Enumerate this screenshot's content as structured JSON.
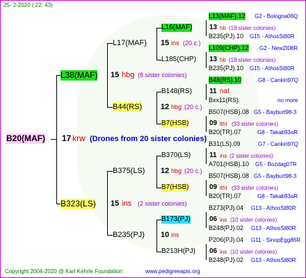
{
  "date": "25-  2-2020 (  22:  43)",
  "footer": {
    "copyright": "Copyright 2004-2020 @ Karl Kehrle Foundation",
    "site": "www.pedigreeapis.org"
  },
  "root": {
    "name": "B20(MAF)",
    "num": "17",
    "code": "krw",
    "drones": "Drones from 20 sister colonies"
  },
  "gen1": [
    {
      "name": "L38(MAF)",
      "num": "15",
      "code": "hbg",
      "note": "(8 sister colonies)"
    },
    {
      "name": "B323(LS)",
      "num": "15",
      "code": "ins",
      "note": "(2 sister colonies)"
    }
  ],
  "gen2": [
    {
      "name": "L17(MAF)",
      "num": "15",
      "code": "ins",
      "note": "(20 c.)"
    },
    {
      "name": "B44(RS)",
      "num": "12",
      "code": "hbg",
      "note": "(20 c.)"
    },
    {
      "name": "B375(LS)",
      "num": "12",
      "code": "hbg",
      "note": "(20 c.)"
    },
    {
      "name": "B235(PJ)",
      "num": "10",
      "code": "ins",
      "note": ""
    }
  ],
  "gen3": [
    {
      "name": "L16(MAF)",
      "num": "13",
      "code": "hb",
      "note": "(18 sister colonies)"
    },
    {
      "name": "L185(CHP)",
      "num": "13",
      "code": "hb",
      "note": "(18 sister colonies)"
    },
    {
      "name": "B148(RS)",
      "num": "11",
      "code": "nat",
      "note": ""
    },
    {
      "name": "B7(HSB)",
      "num": "09",
      "code": "lthl",
      "note": "(33 sister colonies)"
    },
    {
      "name": "B370(LS)",
      "num": "11",
      "code": "ins",
      "note": "(2 sister colonies)"
    },
    {
      "name": "B7(HSB)",
      "num": "09",
      "code": "lthl",
      "note": "(33 sister colonies)"
    },
    {
      "name": "B173(PJ)",
      "num": "06",
      "code": "ins",
      "note": "(10 sister colonies)"
    },
    {
      "name": "B213H(PJ)",
      "num": "06",
      "code": "ins",
      "note": "(10 sister colonies)"
    }
  ],
  "gen4": [
    {
      "left": "L13(MAF).12",
      "right": "G2 - Bologna06Q"
    },
    {
      "left": "B235(PJ).10",
      "right": "G15 - AthosSt80R"
    },
    {
      "left": "L109(CHP).12",
      "right": "G2 - NewZl08R"
    },
    {
      "left": "B235(PJ).10",
      "right": "G15 - AthosSt80R"
    },
    {
      "left": "B48(RS).10",
      "right": "G8 - Cankiri97Q"
    },
    {
      "left": "Bxx11(RS).",
      "right": "no more"
    },
    {
      "left": "B507(HSB).08",
      "right": "G5 - Bayburt98-3"
    },
    {
      "left": "B20(TR).07",
      "right": "G8 - Takab93aR"
    },
    {
      "left": "B31(LS).09",
      "right": "G7 - Cankiri97Q"
    },
    {
      "left": "A701(HSB).10",
      "right": "G5 - Bozdag07R"
    },
    {
      "left": "B507(HSB).08",
      "right": "G5 - Bayburt98-3"
    },
    {
      "left": "B20(TR).07",
      "right": "G8 - Takab93aR"
    },
    {
      "left": "B273(PJ).04",
      "right": "G13 - AthosSt80R"
    },
    {
      "left": "B248(PJ).02",
      "right": "G13 - AthosSt80R"
    },
    {
      "left": "P206(PJ).04",
      "right": "G11 - SinopEgg86R"
    },
    {
      "left": "B248(PJ).02",
      "right": "G13 - AthosSt80R"
    }
  ]
}
